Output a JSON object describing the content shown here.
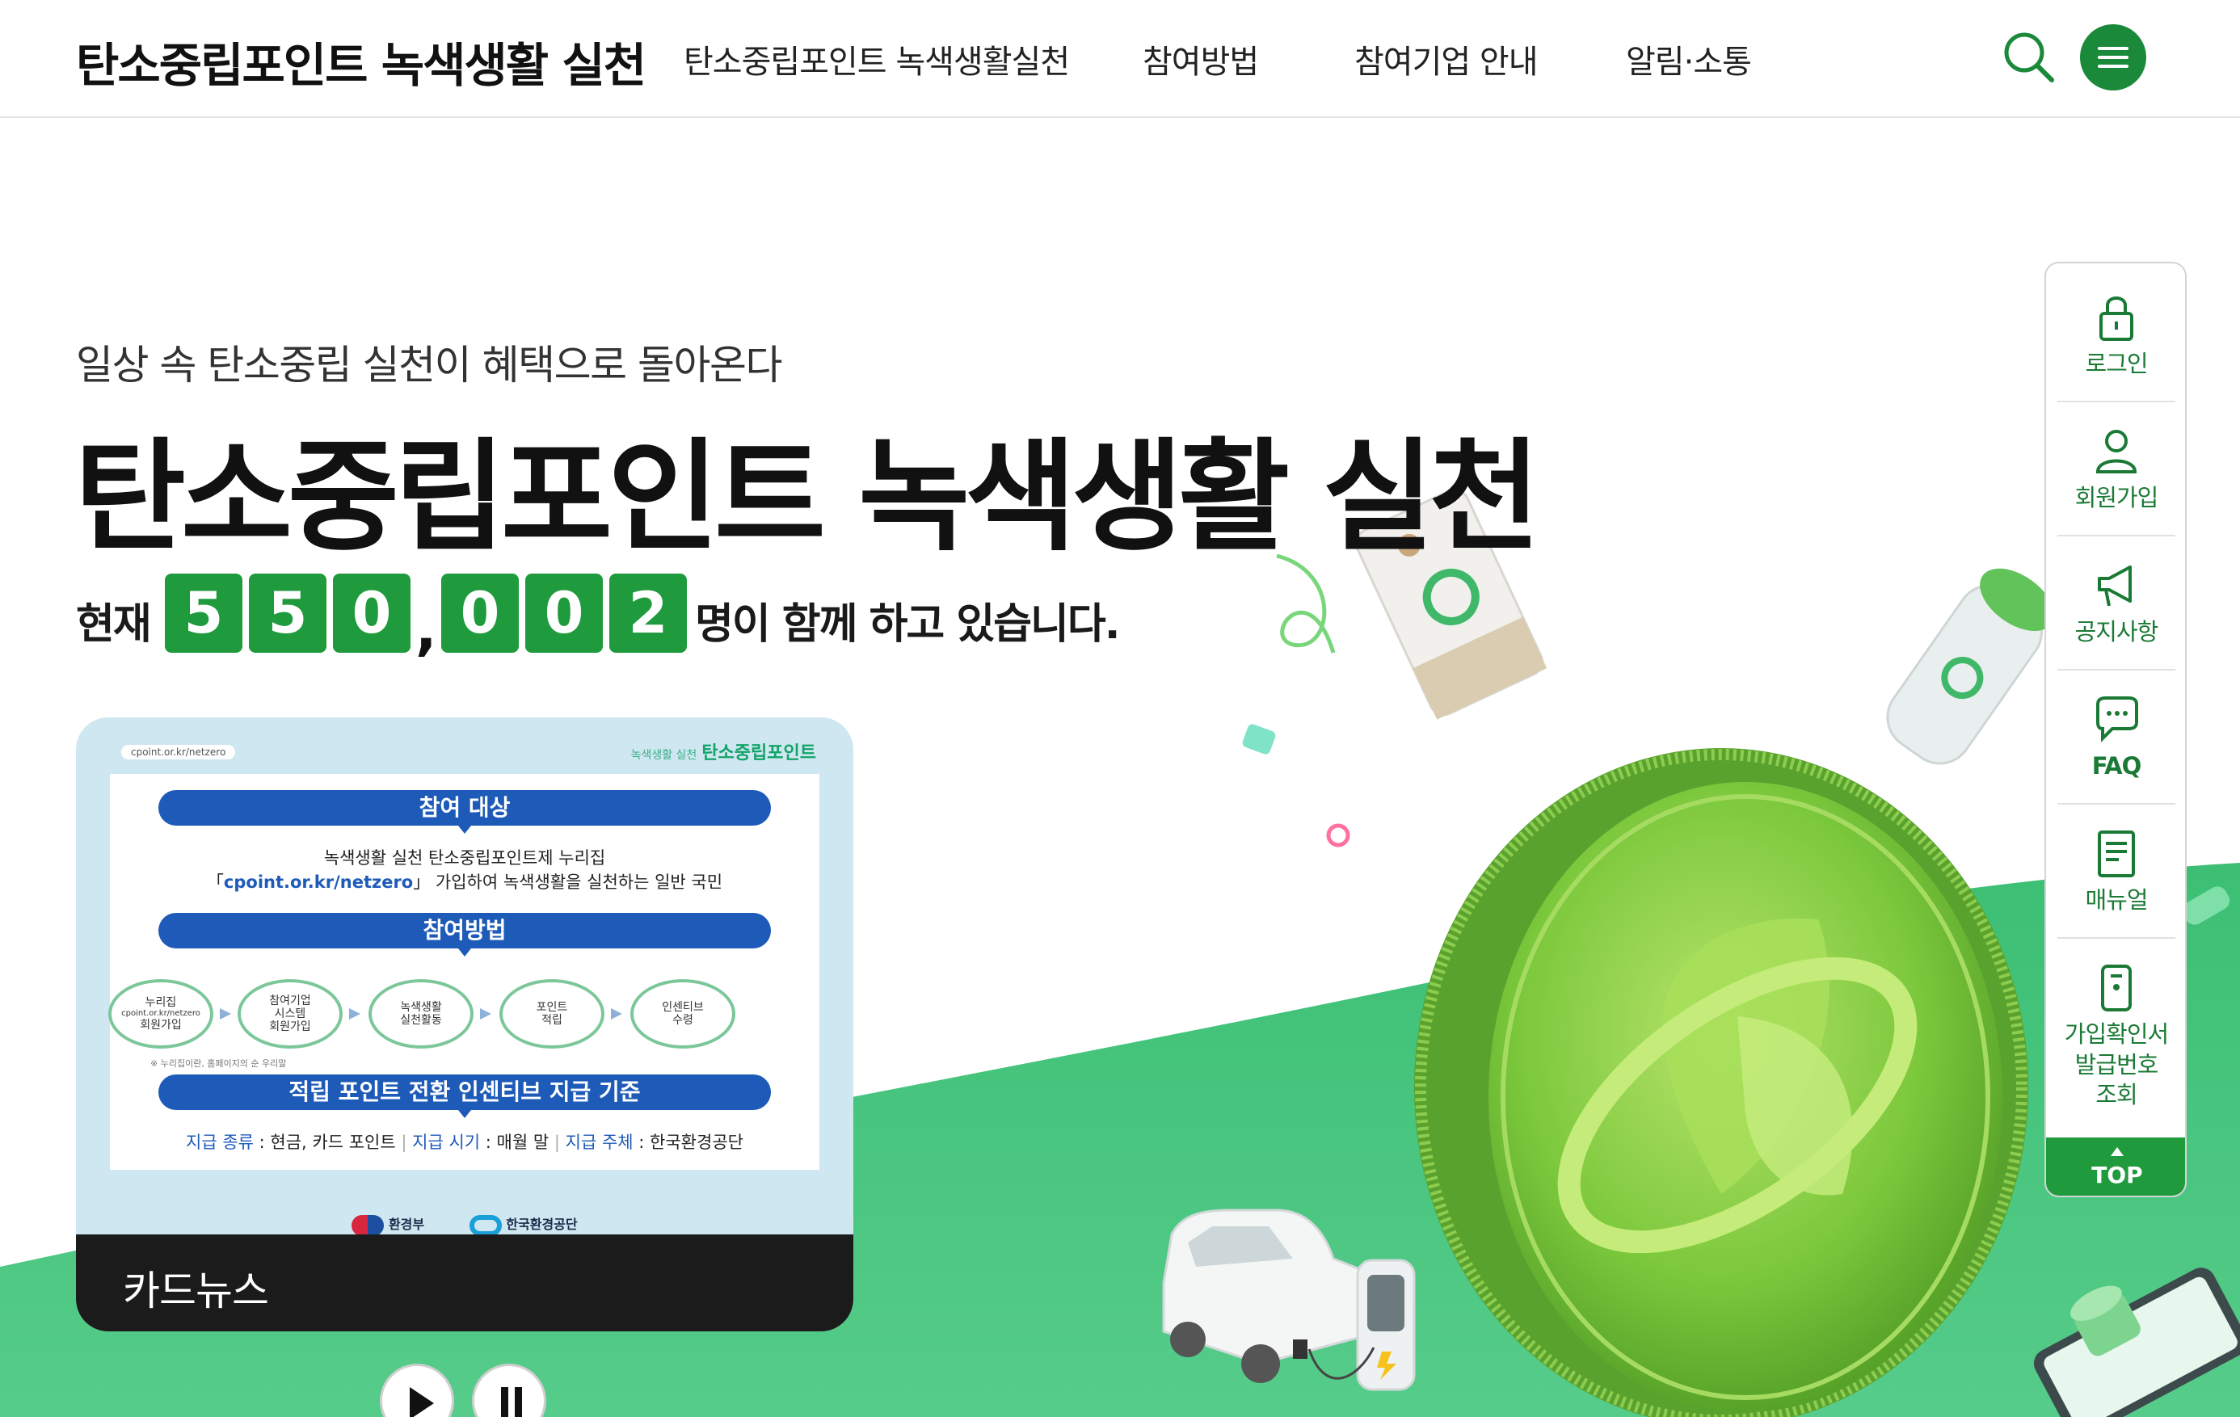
{
  "header": {
    "logo": "탄소중립포인트 녹색생활 실천",
    "nav": [
      {
        "label": "탄소중립포인트 녹색생활실천"
      },
      {
        "label": "참여방법"
      },
      {
        "label": "참여기업 안내"
      },
      {
        "label": "알림·소통"
      }
    ],
    "search_icon": "search-icon",
    "menu_icon": "hamburger-icon"
  },
  "hero": {
    "subtitle": "일상 속 탄소중립 실천이 혜택으로 돌아온다",
    "headline": "탄소중립포인트 녹색생활 실천",
    "counter": {
      "prefix": "현재",
      "digits": [
        "5",
        "5",
        "0",
        "0",
        "0",
        "2"
      ],
      "separator": ",",
      "suffix": "명이 함께 하고 있습니다."
    }
  },
  "card_news": {
    "url": "cpoint.or.kr/netzero",
    "brand_small": "녹색생활 실천",
    "brand": "탄소중립포인트",
    "section1_title": "참여 대상",
    "section1_line1": "녹색생활 실천 탄소중립포인트제 누리집",
    "section1_link": "cpoint.or.kr/netzero",
    "section1_line2a": "「",
    "section1_line2b": "」 가입하여 녹색생활을 실천하는 일반 국민",
    "section2_title": "참여방법",
    "steps": [
      {
        "line1": "누리집",
        "line2": "cpoint.or.kr/netzero",
        "line3": "회원가입"
      },
      {
        "line1": "참여기업",
        "line2": "시스템",
        "line3": "회원가입"
      },
      {
        "line1": "녹색생활",
        "line2": "실천활동",
        "line3": ""
      },
      {
        "line1": "포인트",
        "line2": "적립",
        "line3": ""
      },
      {
        "line1": "인센티브",
        "line2": "수령",
        "line3": ""
      }
    ],
    "note": "※ 누리집이란, 홈페이지의 순 우리말",
    "section3_title": "적립 포인트 전환 인센티브 지급 기준",
    "criteria": [
      {
        "key": "지급 종류",
        "value": "현금, 카드 포인트"
      },
      {
        "key": "지급 시기",
        "value": "매월 말"
      },
      {
        "key": "지급 주체",
        "value": "한국환경공단"
      }
    ],
    "logo1": "환경부",
    "logo2": "한국환경공단",
    "footer_label": "카드뉴스"
  },
  "controls": {
    "play_icon": "play-icon",
    "pause_icon": "pause-icon"
  },
  "quick_menu": {
    "items": [
      {
        "label": "로그인",
        "icon": "lock-icon"
      },
      {
        "label": "회원가입",
        "icon": "user-icon"
      },
      {
        "label": "공지사항",
        "icon": "megaphone-icon"
      },
      {
        "label": "FAQ",
        "icon": "chat-icon"
      },
      {
        "label": "매뉴얼",
        "icon": "document-icon"
      },
      {
        "label": "가입확인서 발급번호 조회",
        "icon": "certificate-icon"
      }
    ],
    "top_label": "TOP"
  },
  "colors": {
    "brand_green": "#1f9a3d",
    "hill_green": "#46c47c",
    "card_blue": "#1e5bb8"
  }
}
